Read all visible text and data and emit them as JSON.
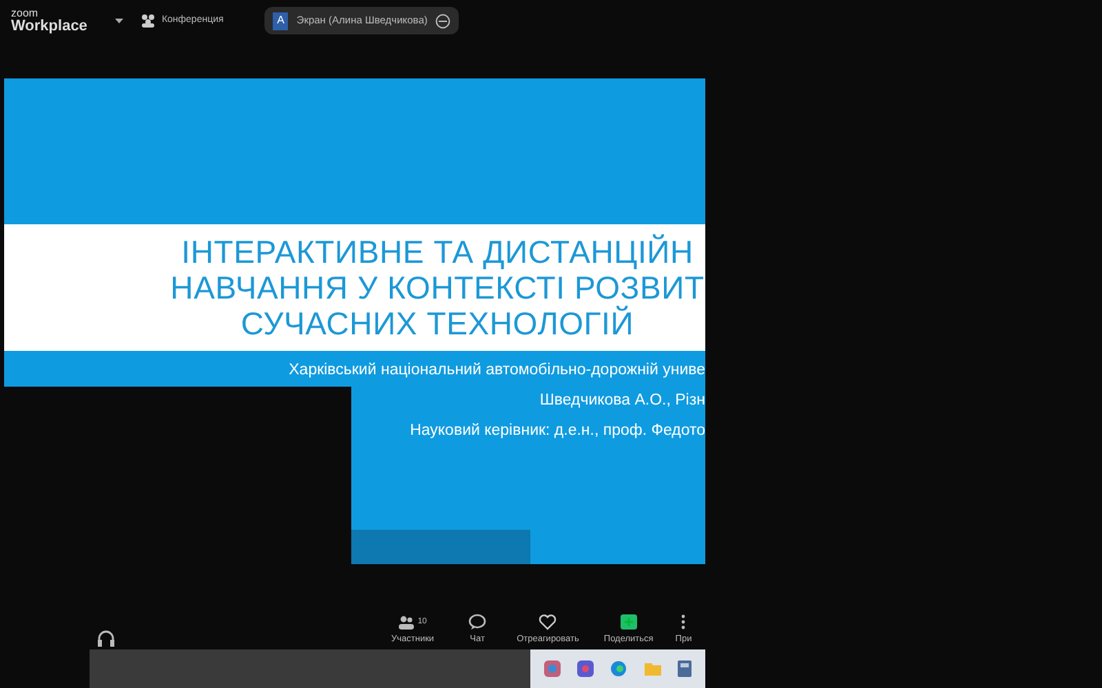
{
  "top_bar": {
    "logo": {
      "line1": "zoom",
      "line2": "Workplace"
    },
    "meeting_label": "Конференция",
    "share_pill": {
      "avatar": "A",
      "label": "Экран (Алина Шведчикова)"
    }
  },
  "slide": {
    "title_lines": [
      "ІНТЕРАКТИВНЕ ТА ДИСТАНЦІЙН",
      "НАВЧАННЯ У КОНТЕКСТІ РОЗВИТ",
      "СУЧАСНИХ ТЕХНОЛОГІЙ"
    ],
    "lines": [
      "Харківський національний автомобільно-дорожній униве",
      "Шведчикова А.О., Різн",
      "Науковий керівник: д.е.н., проф. Федото"
    ]
  },
  "toolbar": {
    "items": [
      {
        "kind": "audio"
      },
      {
        "kind": "participants",
        "label": "Участники",
        "count": "10"
      },
      {
        "kind": "chat",
        "label": "Чат"
      },
      {
        "kind": "react",
        "label": "Отреагировать"
      },
      {
        "kind": "share",
        "label": "Поделиться"
      },
      {
        "kind": "more",
        "label": "При"
      }
    ]
  }
}
